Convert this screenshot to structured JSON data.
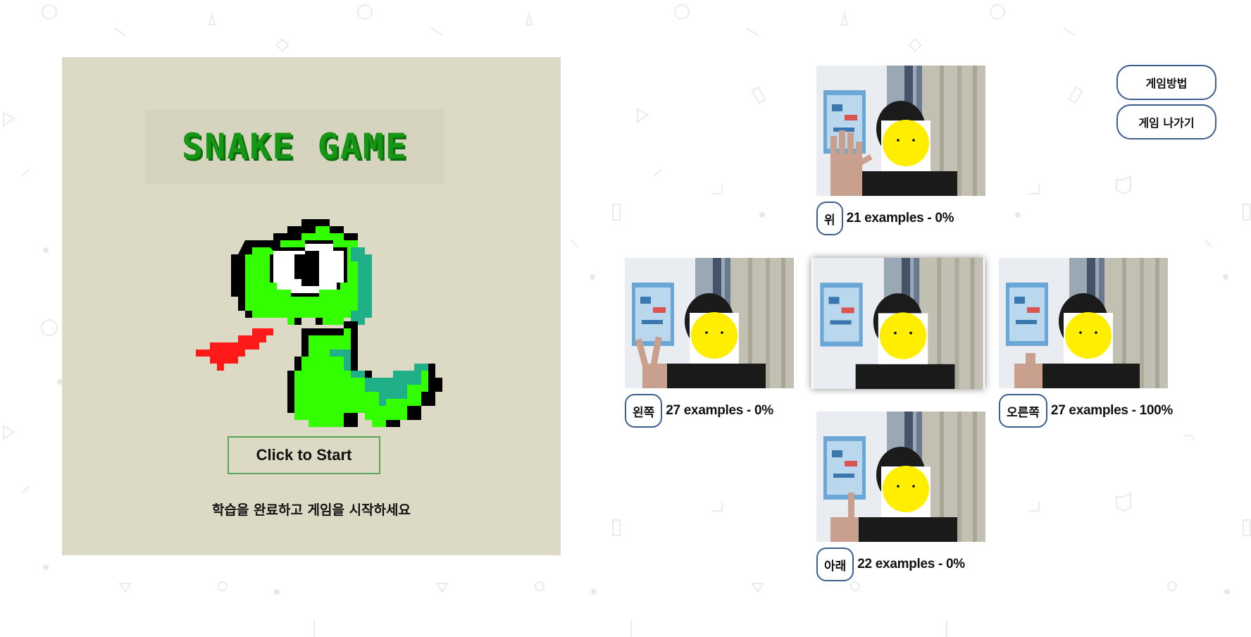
{
  "game": {
    "title": "SNAKE GAME",
    "start_button": "Click to Start",
    "instruction": "학습을 완료하고 게임을 시작하세요"
  },
  "top_buttons": {
    "how_to_play": "게임방법",
    "exit_game": "게임 나가기"
  },
  "classes": {
    "up": {
      "label": "위",
      "stats": "21 examples - 0%"
    },
    "left": {
      "label": "왼쪽",
      "stats": "27 examples - 0%"
    },
    "right": {
      "label": "오른쪽",
      "stats": "27 examples - 100%"
    },
    "down": {
      "label": "아래",
      "stats": "22 examples - 0%"
    }
  },
  "colors": {
    "panel_bg": "#dcdac4",
    "title_green": "#159615",
    "snake_green": "#33ff00",
    "snake_teal": "#1fb08a",
    "tongue_red": "#ff1a1a",
    "button_border": "#3d5e8f",
    "start_border": "#58a658"
  },
  "icons": {
    "hand_gestures": [
      "open-palm",
      "v-sign",
      "fist",
      "index-up"
    ],
    "face_cover": "yellow-smiley"
  }
}
